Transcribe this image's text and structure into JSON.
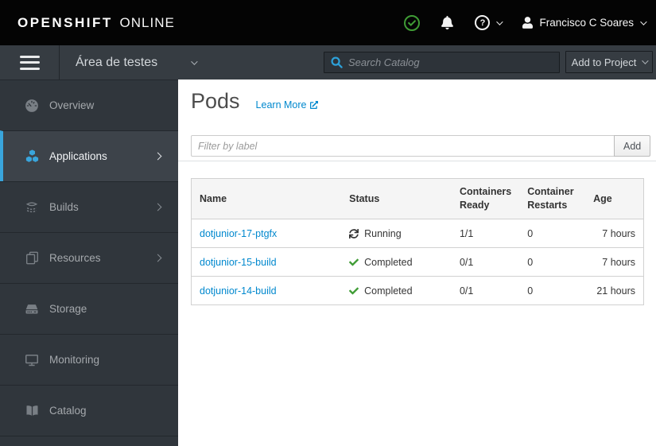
{
  "masthead": {
    "brand_primary": "OPENSHIFT",
    "brand_secondary": "ONLINE",
    "user_name": "Francisco C Soares"
  },
  "toolbar": {
    "project_name": "Área de testes",
    "search_placeholder": "Search Catalog",
    "add_to_project_label": "Add to Project"
  },
  "sidebar": {
    "items": [
      {
        "label": "Overview",
        "icon": "dashboard-icon",
        "active": false,
        "has_submenu": false
      },
      {
        "label": "Applications",
        "icon": "cubes-icon",
        "active": true,
        "has_submenu": true
      },
      {
        "label": "Builds",
        "icon": "builds-icon",
        "active": false,
        "has_submenu": true
      },
      {
        "label": "Resources",
        "icon": "copy-icon",
        "active": false,
        "has_submenu": true
      },
      {
        "label": "Storage",
        "icon": "storage-icon",
        "active": false,
        "has_submenu": false
      },
      {
        "label": "Monitoring",
        "icon": "monitor-icon",
        "active": false,
        "has_submenu": false
      },
      {
        "label": "Catalog",
        "icon": "book-icon",
        "active": false,
        "has_submenu": false
      }
    ]
  },
  "main": {
    "title": "Pods",
    "learn_more_label": "Learn More",
    "filter": {
      "placeholder": "Filter by label",
      "add_button_label": "Add"
    },
    "table": {
      "columns": [
        "Name",
        "Status",
        "Containers Ready",
        "Container Restarts",
        "Age"
      ],
      "rows": [
        {
          "name": "dotjunior-17-ptgfx",
          "status": "Running",
          "status_icon": "refresh-icon",
          "containers_ready": "1/1",
          "container_restarts": "0",
          "age": "7 hours"
        },
        {
          "name": "dotjunior-15-build",
          "status": "Completed",
          "status_icon": "check-icon",
          "containers_ready": "0/1",
          "container_restarts": "0",
          "age": "7 hours"
        },
        {
          "name": "dotjunior-14-build",
          "status": "Completed",
          "status_icon": "check-icon",
          "containers_ready": "0/1",
          "container_restarts": "0",
          "age": "21 hours"
        }
      ]
    }
  },
  "colors": {
    "accent_blue": "#39a5dc",
    "link_blue": "#0088ce",
    "success_green": "#3f9c35",
    "masthead_bg": "#040404",
    "navbar_bg": "#363c42",
    "sidebar_bg": "#30363c",
    "sidebar_active_bg": "#3d434a",
    "table_header_bg": "#f5f5f5",
    "table_border": "#d1d1d1"
  }
}
